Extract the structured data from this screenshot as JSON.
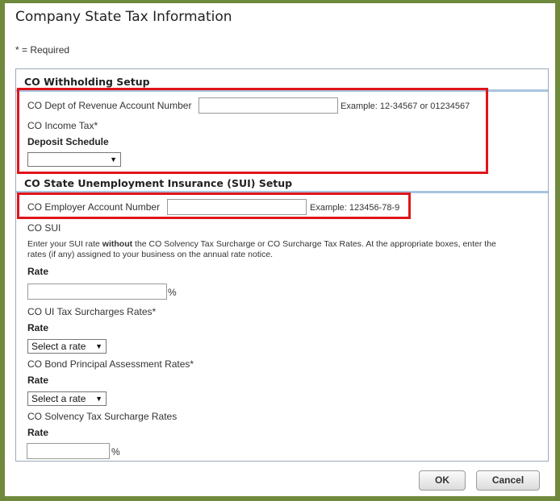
{
  "dialog": {
    "title": "Company State Tax Information",
    "required_note": "* = Required"
  },
  "withholding": {
    "header": "CO Withholding Setup",
    "account_label": "CO Dept of Revenue Account Number",
    "account_value": "",
    "account_example": "Example: 12-34567 or 01234567",
    "income_tax_label": "CO Income Tax*",
    "deposit_schedule_label": "Deposit Schedule",
    "deposit_schedule_value": ""
  },
  "sui": {
    "header": "CO State Unemployment Insurance (SUI) Setup",
    "employer_label": "CO Employer Account Number",
    "employer_value": "",
    "employer_example": "Example: 123456-78-9",
    "sui_label": "CO SUI",
    "description_pre": "Enter your SUI rate ",
    "description_bold": "without",
    "description_post": " the CO Solvency Tax Surcharge or CO Surcharge Tax Rates. At the appropriate boxes, enter the rates (if any) assigned to your business on the annual rate notice.",
    "rate_label": "Rate",
    "percent": "%",
    "ui_surcharge_label": "CO UI Tax Surcharges Rates*",
    "ui_surcharge_select": "Select a rate",
    "bond_label": "CO Bond Principal Assessment Rates*",
    "bond_select": "Select a rate",
    "solvency_label": "CO Solvency Tax Surcharge Rates"
  },
  "buttons": {
    "ok": "OK",
    "cancel": "Cancel"
  }
}
